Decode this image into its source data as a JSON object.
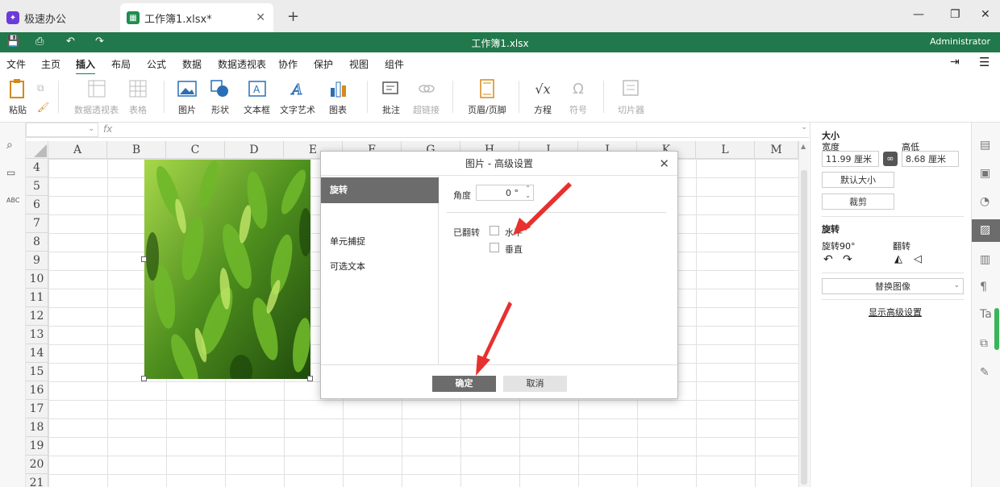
{
  "tabs": [
    {
      "label": "极速办公",
      "icon": "rocket-icon"
    },
    {
      "label": "工作簿1.xlsx*",
      "icon": "spreadsheet-icon"
    }
  ],
  "window": {
    "title": "工作簿1.xlsx",
    "user": "Administrator"
  },
  "menu": [
    "文件",
    "主页",
    "插入",
    "布局",
    "公式",
    "数据",
    "数据透视表",
    "协作",
    "保护",
    "视图",
    "组件"
  ],
  "toolbar": {
    "paste": "粘贴",
    "pivot": "数据透视表",
    "table": "表格",
    "picture": "图片",
    "shape": "形状",
    "textbox": "文本框",
    "wordart": "文字艺术",
    "chart": "图表",
    "comment": "批注",
    "hyperlink": "超链接",
    "header_footer": "页眉/页脚",
    "equation": "方程",
    "symbol": "符号",
    "slicer": "切片器"
  },
  "formula_bar": {
    "fx": "fx"
  },
  "columns": [
    "A",
    "B",
    "C",
    "D",
    "E",
    "F",
    "G",
    "H",
    "I",
    "J",
    "K",
    "L",
    "M"
  ],
  "rows": [
    "4",
    "5",
    "6",
    "7",
    "8",
    "9",
    "10",
    "11",
    "12",
    "13",
    "14",
    "15",
    "16",
    "17",
    "18",
    "19",
    "20",
    "21"
  ],
  "dialog": {
    "title": "图片 - 高级设置",
    "nav": [
      "旋转",
      "单元捕捉",
      "可选文本"
    ],
    "angle_label": "角度",
    "angle_value": "0 °",
    "flipped_label": "已翻转",
    "horizontal": "水平",
    "vertical": "垂直",
    "ok": "确定",
    "cancel": "取消"
  },
  "right_panel": {
    "size_title": "大小",
    "width_label": "宽度",
    "width_value": "11.99 厘米",
    "height_label": "高低",
    "height_value": "8.68 厘米",
    "default_size": "默认大小",
    "crop": "裁剪",
    "rotation_title": "旋转",
    "rotate90": "旋转90°",
    "flip": "翻转",
    "replace_image": "替换图像",
    "advanced": "显示高级设置"
  }
}
